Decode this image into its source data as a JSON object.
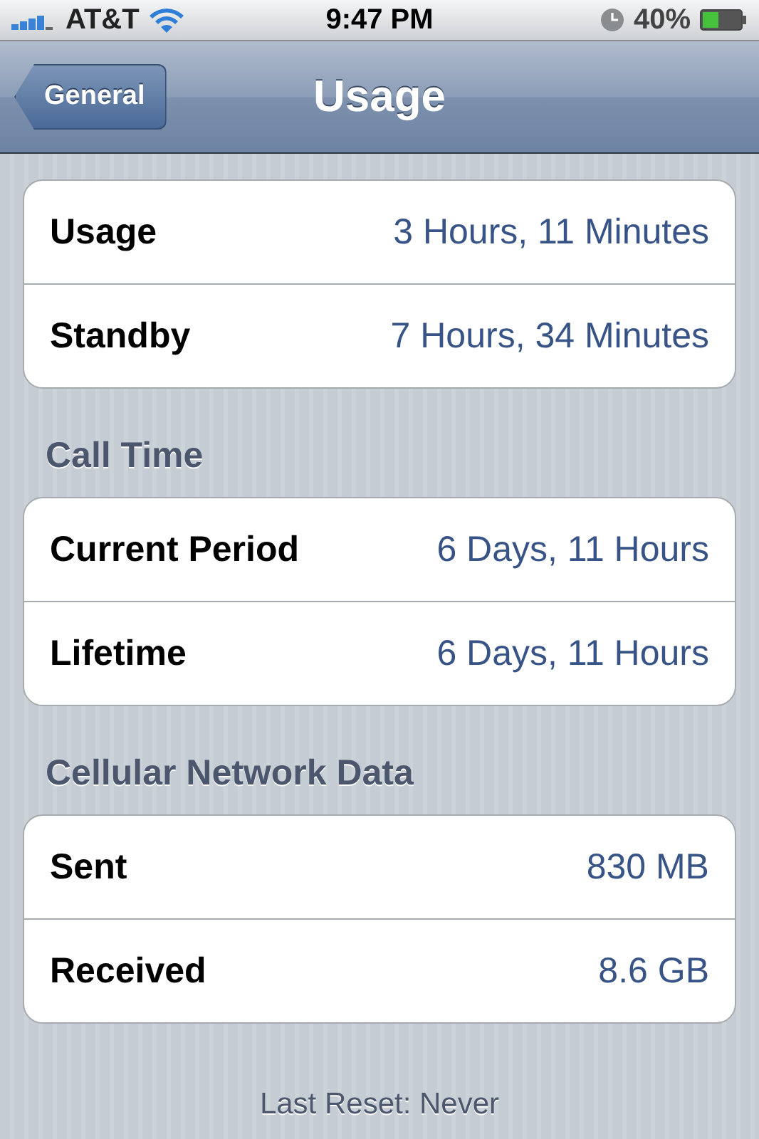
{
  "status_bar": {
    "carrier": "AT&T",
    "time": "9:47 PM",
    "battery": "40%"
  },
  "nav_bar": {
    "back": "General",
    "title": "Usage"
  },
  "groups": [
    {
      "rows": [
        {
          "label": "Usage",
          "value": "3 Hours, 11 Minutes"
        },
        {
          "label": "Standby",
          "value": "7 Hours, 34 Minutes"
        }
      ]
    },
    {
      "header": "Call Time",
      "rows": [
        {
          "label": "Current Period",
          "value": "6 Days, 11 Hours"
        },
        {
          "label": "Lifetime",
          "value": "6 Days, 11 Hours"
        }
      ]
    },
    {
      "header": "Cellular Network Data",
      "rows": [
        {
          "label": "Sent",
          "value": "830 MB"
        },
        {
          "label": "Received",
          "value": "8.6 GB"
        }
      ]
    }
  ],
  "footer": "Last Reset: Never"
}
